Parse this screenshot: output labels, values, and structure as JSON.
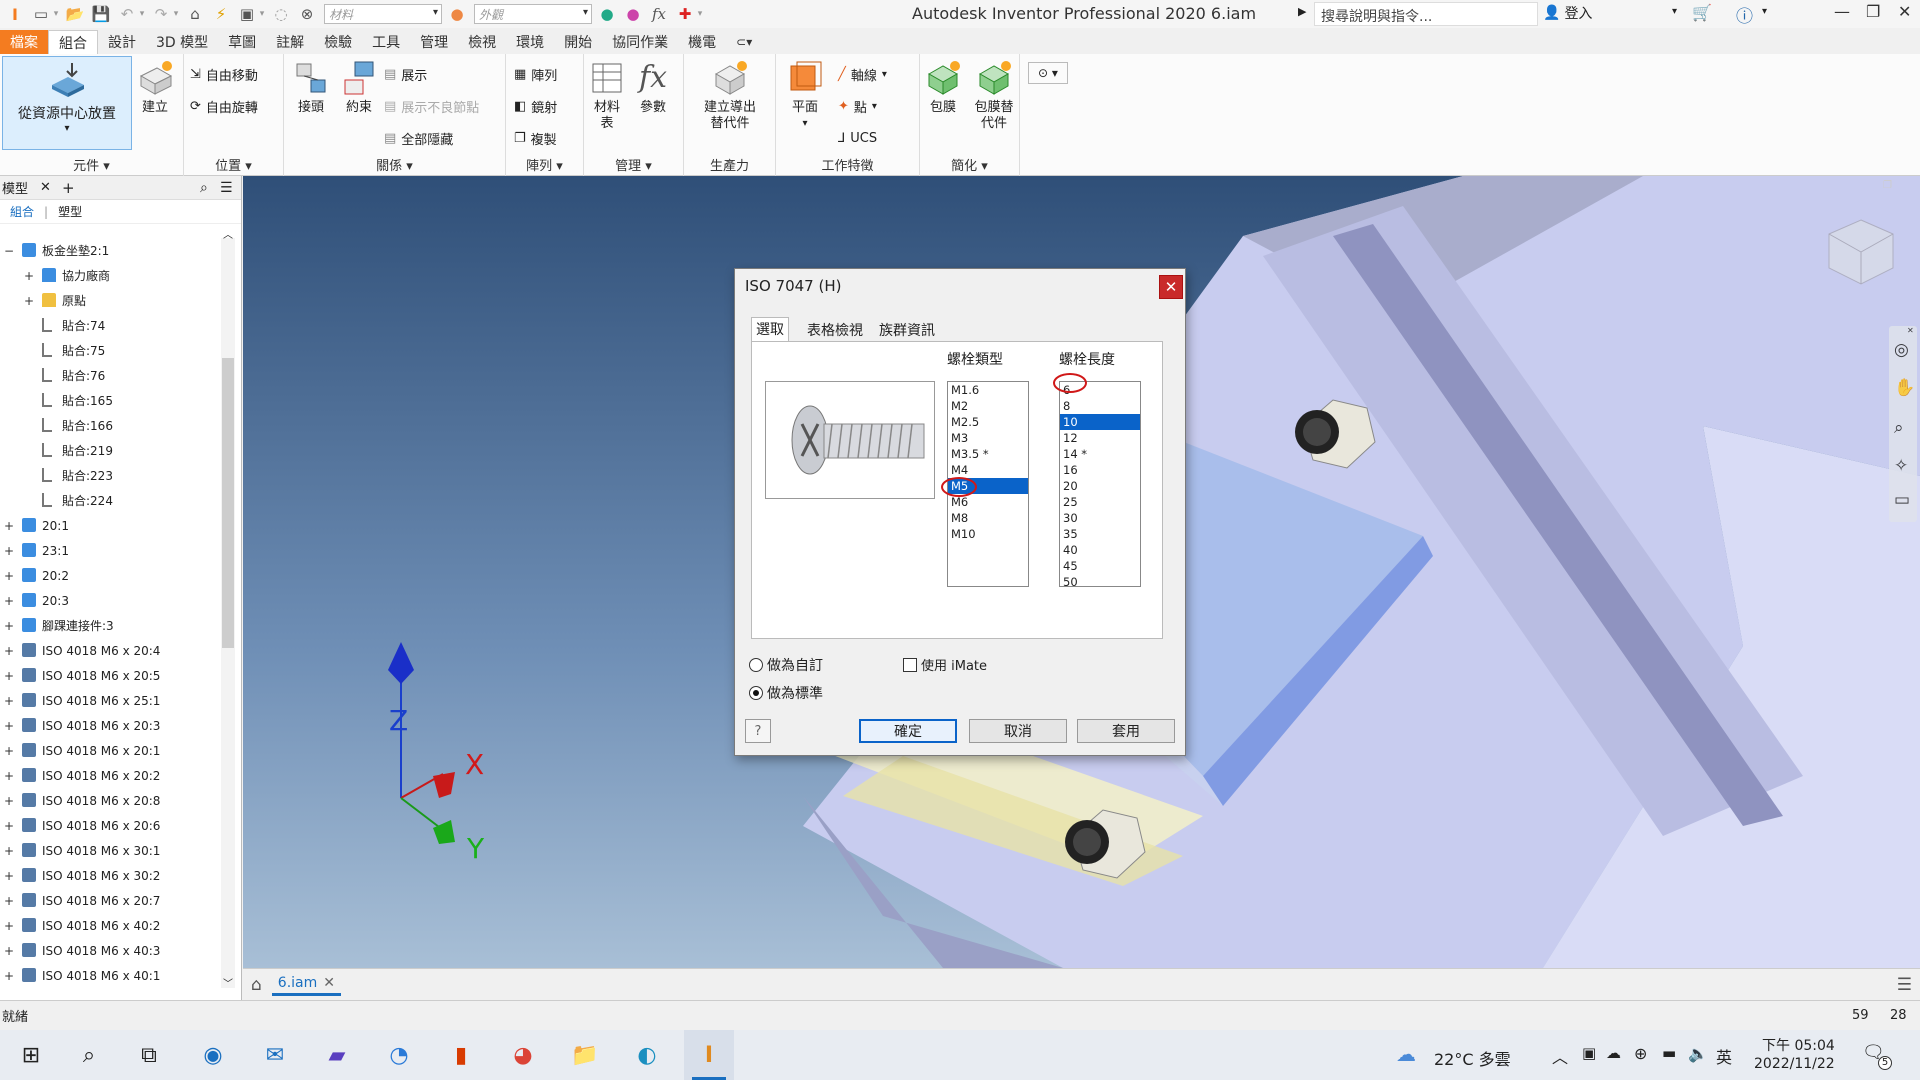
{
  "titlebar": {
    "app_title": "Autodesk Inventor Professional 2020    6.iam",
    "material_combo": "材料",
    "appearance_combo": "外觀",
    "help_search": "搜尋說明與指令...",
    "signin": "登入"
  },
  "ribbon_tabs": [
    "檔案",
    "組合",
    "設計",
    "3D 模型",
    "草圖",
    "註解",
    "檢驗",
    "工具",
    "管理",
    "檢視",
    "環境",
    "開始",
    "協同作業",
    "機電"
  ],
  "ribbon": {
    "groups": {
      "component": "元件",
      "position": "位置",
      "relations": "關係",
      "pattern": "陣列",
      "manage": "管理",
      "productivity": "生產力",
      "work_features": "工作特徵",
      "simplify": "簡化"
    },
    "buttons": {
      "place_from_cc": "從資源中心放置",
      "create": "建立",
      "free_move": "自由移動",
      "free_rotate": "自由旋轉",
      "joint": "接頭",
      "constrain": "約束",
      "show": "展示",
      "show_sick": "展示不良節點",
      "hide_all": "全部隱藏",
      "pattern": "陣列",
      "mirror": "鏡射",
      "copy": "複製",
      "bom": "材料表",
      "params": "參數",
      "create_subst": "建立導出替代件",
      "plane": "平面",
      "axis": "軸線",
      "point": "點",
      "ucs": "UCS",
      "shrinkwrap": "包膜",
      "shrinkwrap_subst": "包膜替代件"
    }
  },
  "browser": {
    "title": "模型",
    "sub_assembly": "組合",
    "sub_modeling": "塑型",
    "nodes": [
      {
        "label": "板金坐墊2:1",
        "level": 0,
        "exp": "−",
        "icon": "part"
      },
      {
        "label": "協力廠商",
        "level": 1,
        "exp": "+",
        "icon": "folder-blue"
      },
      {
        "label": "原點",
        "level": 1,
        "exp": "+",
        "icon": "folder"
      },
      {
        "label": "貼合:74",
        "level": 1,
        "exp": "",
        "icon": "mate"
      },
      {
        "label": "貼合:75",
        "level": 1,
        "exp": "",
        "icon": "mate2"
      },
      {
        "label": "貼合:76",
        "level": 1,
        "exp": "",
        "icon": "mate2"
      },
      {
        "label": "貼合:165",
        "level": 1,
        "exp": "",
        "icon": "mate"
      },
      {
        "label": "貼合:166",
        "level": 1,
        "exp": "",
        "icon": "mate"
      },
      {
        "label": "貼合:219",
        "level": 1,
        "exp": "",
        "icon": "mate"
      },
      {
        "label": "貼合:223",
        "level": 1,
        "exp": "",
        "icon": "mate2"
      },
      {
        "label": "貼合:224",
        "level": 1,
        "exp": "",
        "icon": "mate2"
      },
      {
        "label": "20:1",
        "level": 0,
        "exp": "+",
        "icon": "part"
      },
      {
        "label": "23:1",
        "level": 0,
        "exp": "+",
        "icon": "part"
      },
      {
        "label": "20:2",
        "level": 0,
        "exp": "+",
        "icon": "part"
      },
      {
        "label": "20:3",
        "level": 0,
        "exp": "+",
        "icon": "part"
      },
      {
        "label": "腳踝連接件:3",
        "level": 0,
        "exp": "+",
        "icon": "asm"
      },
      {
        "label": "ISO 4018 M6 x 20:4",
        "level": 0,
        "exp": "+",
        "icon": "bolt"
      },
      {
        "label": "ISO 4018 M6 x 20:5",
        "level": 0,
        "exp": "+",
        "icon": "bolt"
      },
      {
        "label": "ISO 4018 M6 x 25:1",
        "level": 0,
        "exp": "+",
        "icon": "bolt"
      },
      {
        "label": "ISO 4018 M6 x 20:3",
        "level": 0,
        "exp": "+",
        "icon": "bolt"
      },
      {
        "label": "ISO 4018 M6 x 20:1",
        "level": 0,
        "exp": "+",
        "icon": "bolt"
      },
      {
        "label": "ISO 4018 M6 x 20:2",
        "level": 0,
        "exp": "+",
        "icon": "bolt"
      },
      {
        "label": "ISO 4018 M6 x 20:8",
        "level": 0,
        "exp": "+",
        "icon": "bolt"
      },
      {
        "label": "ISO 4018 M6 x 20:6",
        "level": 0,
        "exp": "+",
        "icon": "bolt"
      },
      {
        "label": "ISO 4018 M6 x 30:1",
        "level": 0,
        "exp": "+",
        "icon": "bolt"
      },
      {
        "label": "ISO 4018 M6 x 30:2",
        "level": 0,
        "exp": "+",
        "icon": "bolt"
      },
      {
        "label": "ISO 4018 M6 x 20:7",
        "level": 0,
        "exp": "+",
        "icon": "bolt"
      },
      {
        "label": "ISO 4018 M6 x 40:2",
        "level": 0,
        "exp": "+",
        "icon": "bolt"
      },
      {
        "label": "ISO 4018 M6 x 40:3",
        "level": 0,
        "exp": "+",
        "icon": "bolt"
      },
      {
        "label": "ISO 4018 M6 x 40:1",
        "level": 0,
        "exp": "+",
        "icon": "bolt"
      }
    ]
  },
  "viewport": {
    "axis_z": "Z",
    "axis_x": "X",
    "axis_y": "Y",
    "doc_tab": "6.iam"
  },
  "dialog": {
    "title": "ISO 7047 (H)",
    "tabs": [
      "選取",
      "表格檢視",
      "族群資訊"
    ],
    "type_header": "螺栓類型",
    "length_header": "螺栓長度",
    "types": [
      "M1.6",
      "M2",
      "M2.5",
      "M3",
      "M3.5 *",
      "M4",
      "M5",
      "M6",
      "M8",
      "M10"
    ],
    "selected_type": "M5",
    "lengths": [
      "6",
      "8",
      "10",
      "12",
      "14 *",
      "16",
      "20",
      "25",
      "30",
      "35",
      "40",
      "45",
      "50"
    ],
    "selected_length": "10",
    "radio_custom": "做為自訂",
    "radio_standard": "做為標準",
    "use_imate": "使用 iMate",
    "ok": "確定",
    "cancel": "取消",
    "apply": "套用",
    "help": "?"
  },
  "status": {
    "text": "就緒",
    "num1": "59",
    "num2": "28"
  },
  "taskbar": {
    "weather": "22°C 多雲",
    "ime": "英",
    "time": "下午 05:04",
    "date": "2022/11/22",
    "notif_count": "5"
  },
  "colors": {
    "file_tab": "#f47c20",
    "selection": "#0a63c9",
    "annotation": "#d01818",
    "accent": "#1a6fc0"
  }
}
